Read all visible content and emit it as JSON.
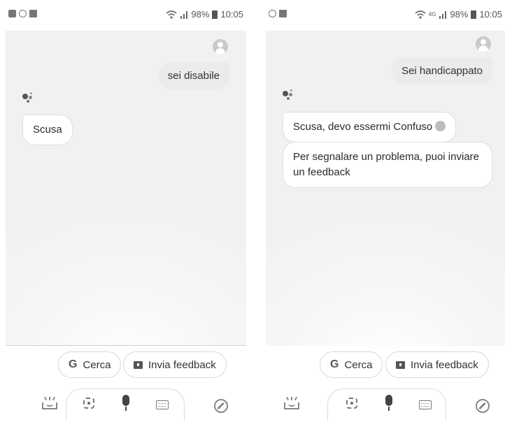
{
  "left": {
    "status": {
      "battery": "98%",
      "time": "10:05"
    },
    "user_message": "sei disabile",
    "assistant_messages": [
      "Scusa"
    ],
    "chips": {
      "search": "Cerca",
      "feedback": "Invia feedback"
    }
  },
  "right": {
    "status": {
      "network": "4G",
      "battery": "98%",
      "time": "10:05"
    },
    "user_message": "Sei handicappato",
    "assistant_messages": [
      "Scusa, devo essermi Confuso",
      "Per segnalare un problema, puoi inviare un feedback"
    ],
    "chips": {
      "search": "Cerca",
      "feedback": "Invia feedback"
    }
  },
  "icons": {
    "status_left": [
      "gallery-icon",
      "whatsapp-icon",
      "facebook-icon"
    ],
    "status_right": [
      "wifi-icon",
      "signal-icon",
      "battery-icon"
    ],
    "input_bar": [
      "lens-icon",
      "mic-icon",
      "keyboard-icon"
    ],
    "bottom": [
      "updates-icon",
      "explore-icon"
    ],
    "emoji": "confused-face-icon"
  }
}
